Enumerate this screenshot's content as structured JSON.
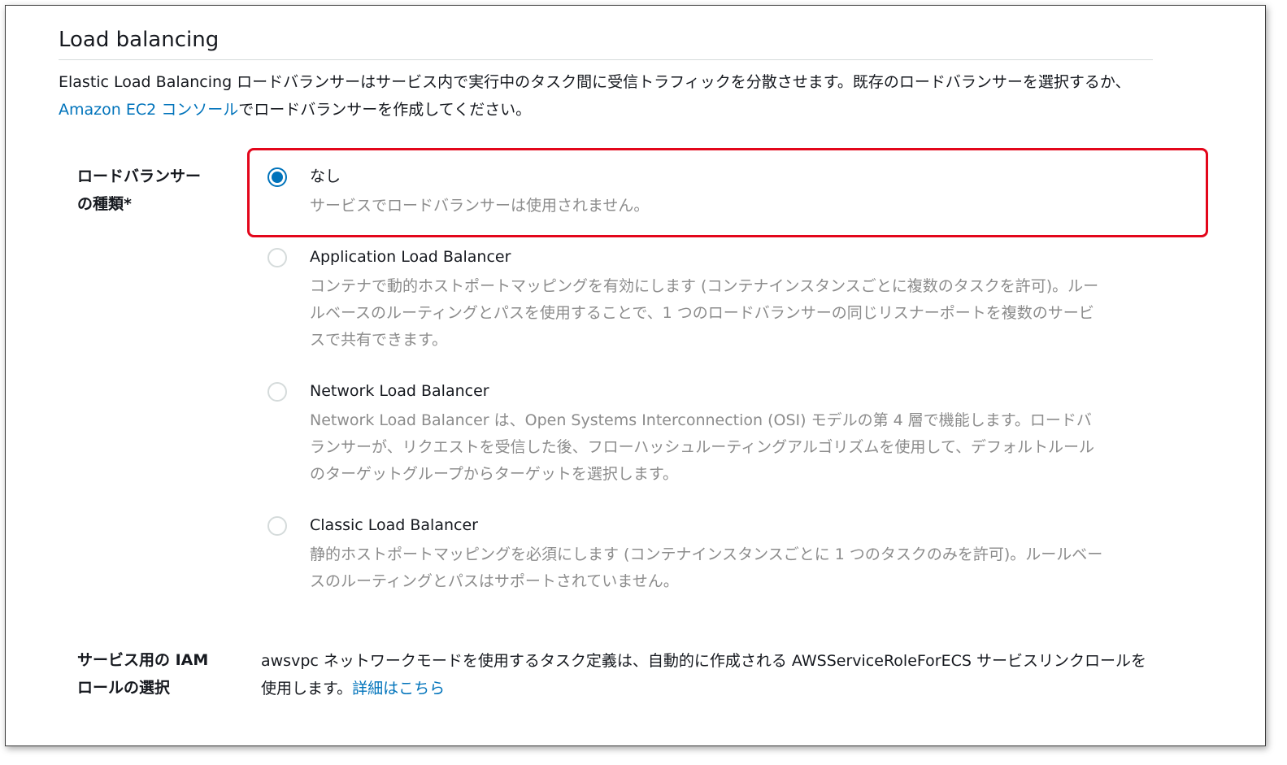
{
  "section": {
    "title": "Load balancing",
    "description_pre": "Elastic Load Balancing ロードバランサーはサービス内で実行中のタスク間に受信トラフィックを分散させます。既存のロードバランサーを選択するか、",
    "description_link": "Amazon EC2 コンソール",
    "description_post": "でロードバランサーを作成してください。"
  },
  "load_balancer_type": {
    "label": "ロードバランサーの種類*",
    "selected": "none",
    "options": [
      {
        "title": "なし",
        "description": "サービスでロードバランサーは使用されません。",
        "checked": true
      },
      {
        "title": "Application Load Balancer",
        "description": "コンテナで動的ホストポートマッピングを有効にします (コンテナインスタンスごとに複数のタスクを許可)。ルールベースのルーティングとパスを使用することで、1 つのロードバランサーの同じリスナーポートを複数のサービスで共有できます。",
        "checked": false
      },
      {
        "title": "Network Load Balancer",
        "description": "Network Load Balancer は、Open Systems Interconnection (OSI) モデルの第 4 層で機能します。ロードバランサーが、リクエストを受信した後、フローハッシュルーティングアルゴリズムを使用して、デフォルトルールのターゲットグループからターゲットを選択します。",
        "checked": false
      },
      {
        "title": "Classic Load Balancer",
        "description": "静的ホストポートマッピングを必須にします (コンテナインスタンスごとに 1 つのタスクのみを許可)。ルールベースのルーティングとパスはサポートされていません。",
        "checked": false
      }
    ]
  },
  "iam_role": {
    "label": "サービス用の IAM ロールの選択",
    "text": "awsvpc ネットワークモードを使用するタスク定義は、自動的に作成される AWSServiceRoleForECS サービスリンクロールを使用します。",
    "link": "詳細はこちら"
  },
  "colors": {
    "link": "#0073bb",
    "radio_selected": "#0073bb",
    "highlight_border": "#e3061b",
    "muted_text": "#8c8c8c"
  }
}
